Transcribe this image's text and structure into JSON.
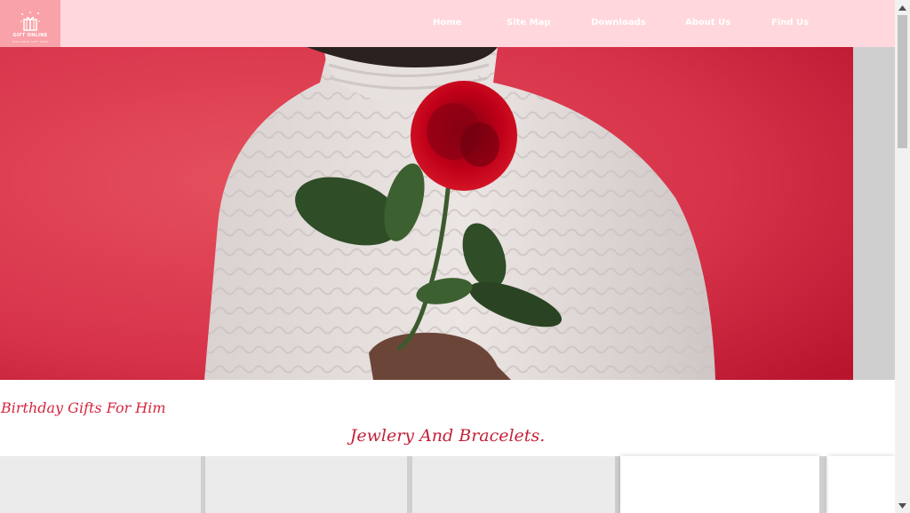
{
  "header": {
    "logo_text": "GIFT ONLINE",
    "logo_subtext": "YOUR BEST GIFT SHOP",
    "nav": [
      {
        "label": "Home"
      },
      {
        "label": "Site Map"
      },
      {
        "label": "Downloads"
      },
      {
        "label": "About Us"
      },
      {
        "label": "Find Us"
      }
    ]
  },
  "hero": {
    "image": "man-in-white-sweater-holding-red-rose"
  },
  "main": {
    "subtitle": "Birthday Gifts For Him",
    "section_title": "Jewlery And Bracelets."
  },
  "colors": {
    "header_bg": "#ffd7dc",
    "logo_bg": "#f9a2a9",
    "hero_red": "#d83247",
    "title_red": "#c3223a"
  },
  "cards_count": 5
}
